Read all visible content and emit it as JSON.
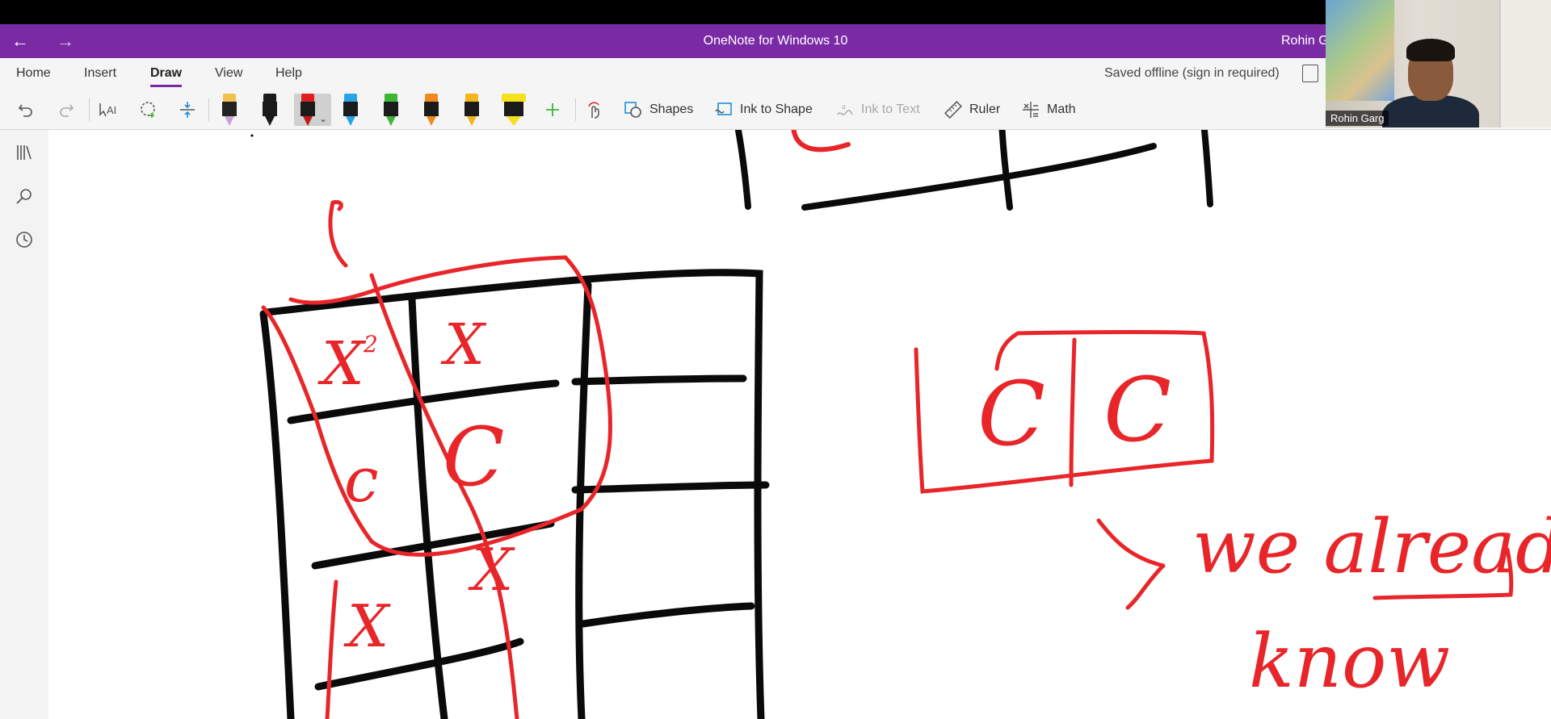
{
  "titlebar": {
    "back_label": "←",
    "forward_label": "→",
    "title": "OneNote for Windows 10",
    "user": "Rohin G"
  },
  "ribbon": {
    "tabs": [
      {
        "label": "Home"
      },
      {
        "label": "Insert"
      },
      {
        "label": "Draw",
        "active": true
      },
      {
        "label": "View"
      },
      {
        "label": "Help"
      }
    ],
    "status": "Saved offline (sign in required)",
    "pens": [
      {
        "color": "#c9a2d8",
        "kind": "pencil"
      },
      {
        "color": "#1b1b1b",
        "kind": "pen"
      },
      {
        "color": "#e02020",
        "kind": "pen",
        "selected": true
      },
      {
        "color": "#2aa3e8",
        "kind": "pen"
      },
      {
        "color": "#3fb536",
        "kind": "pen"
      },
      {
        "color": "#f08a1f",
        "kind": "pen"
      },
      {
        "color": "#f2b51c",
        "kind": "pen"
      },
      {
        "color": "#f5e21c",
        "kind": "highlighter"
      }
    ],
    "buttons": {
      "shapes": "Shapes",
      "ink_to_shape": "Ink to Shape",
      "ink_to_text": "Ink to Text",
      "ruler": "Ruler",
      "math": "Math"
    }
  },
  "video": {
    "participant_name": "Rohin Garg"
  },
  "canvas": {
    "handwriting": {
      "cell1": "X",
      "cell1_sup": "2",
      "cell2": "X",
      "cell3": "c",
      "cell4": "C",
      "cell5": "X",
      "cell6": "X",
      "right_box_left": "C",
      "right_box_right": "C",
      "note_line1": "we already",
      "note_line2": "know"
    }
  },
  "colors": {
    "accent": "#7b2aa5",
    "ink_red": "#e8262a",
    "ink_black": "#0a0a0a"
  }
}
